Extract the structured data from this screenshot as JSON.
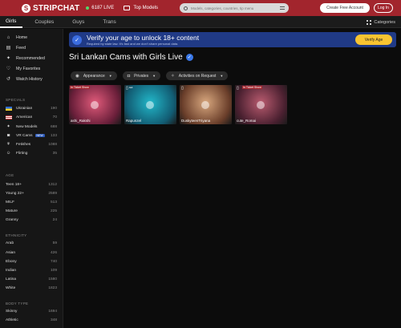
{
  "header": {
    "logo_text": "STRIPCHAT",
    "live_count": "6187 LIVE",
    "top_models": "Top Models",
    "search_placeholder": "Models, categories, countries, tip menu",
    "create_account": "Create Free Account",
    "login": "Log In"
  },
  "subnav": {
    "tabs": [
      "Girls",
      "Couples",
      "Guys",
      "Trans"
    ],
    "categories": "Categories"
  },
  "sidebar": {
    "nav": [
      "Home",
      "Feed",
      "Recommended",
      "My Favorites",
      "Watch History"
    ],
    "specials_title": "SPECIALS",
    "specials": [
      {
        "label": "Ukrainian",
        "count": "190"
      },
      {
        "label": "American",
        "count": "70"
      },
      {
        "label": "New Models",
        "count": "688"
      },
      {
        "label": "VR Cams",
        "badge": "NEW",
        "count": "133"
      },
      {
        "label": "Fetishes",
        "count": "1088"
      },
      {
        "label": "Flirting",
        "count": "35"
      }
    ],
    "age_title": "AGE",
    "age": [
      {
        "label": "Teen 18+",
        "count": "1312"
      },
      {
        "label": "Young 22+",
        "count": "2589"
      },
      {
        "label": "MILF",
        "count": "513"
      },
      {
        "label": "Mature",
        "count": "225"
      },
      {
        "label": "Granny",
        "count": "24"
      }
    ],
    "ethnicity_title": "ETHNICITY",
    "ethnicity": [
      {
        "label": "Arab",
        "count": "59"
      },
      {
        "label": "Asian",
        "count": "426"
      },
      {
        "label": "Ebony",
        "count": "740"
      },
      {
        "label": "Indian",
        "count": "109"
      },
      {
        "label": "Latina",
        "count": "1580"
      },
      {
        "label": "White",
        "count": "1823"
      }
    ],
    "bodytype_title": "BODY TYPE",
    "bodytype": [
      {
        "label": "Skinny",
        "count": "1694"
      },
      {
        "label": "Athletic",
        "count": "348"
      }
    ]
  },
  "main": {
    "banner_title": "Verify your age to unlock 18+ content",
    "banner_sub": "Required by state law. It's fast and we don't share personal data.",
    "verify_button": "Verify Age",
    "page_title": "Sri Lankan Cams with Girls Live",
    "filters": [
      "Appearance",
      "Privates",
      "Activities on Request"
    ],
    "cards": [
      {
        "name": "ashi_Rakshi",
        "badge": "In Ticket Show",
        "color1": "#e05a7a",
        "color2": "#6a1f3a"
      },
      {
        "name": "Rapunzel",
        "badge": "",
        "color1": "#22b7c9",
        "color2": "#125c73"
      },
      {
        "name": "DuskyteenTriyana",
        "badge": "",
        "color1": "#d8a77e",
        "color2": "#6a3e2a"
      },
      {
        "name": "cute_Romai",
        "badge": "In Ticket Show",
        "color1": "#b95b6f",
        "color2": "#4a2030"
      }
    ]
  },
  "colors": {
    "brand": "#a2252d",
    "banner": "#203a86",
    "verify": "#f8c431"
  }
}
